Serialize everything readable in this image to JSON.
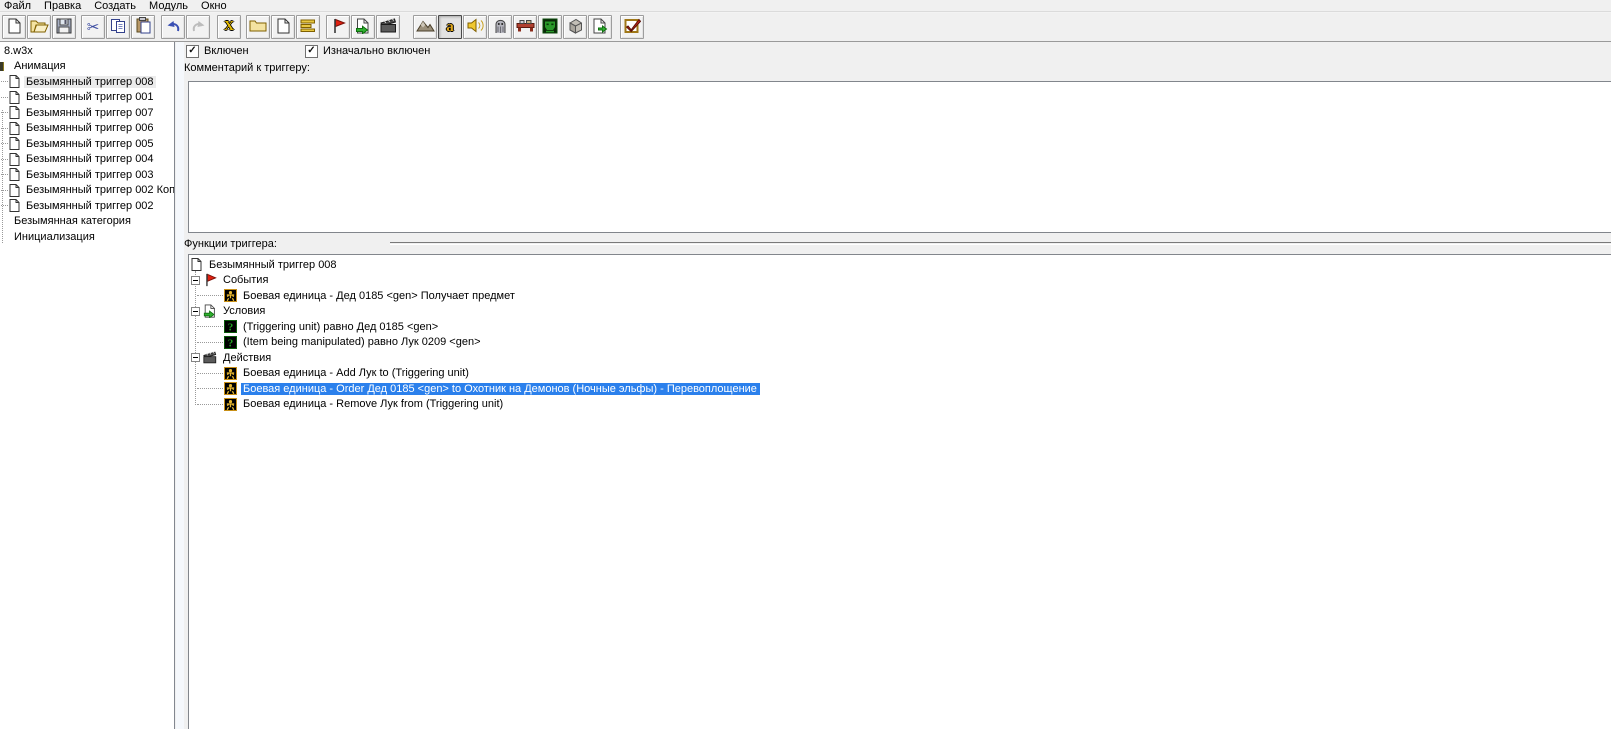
{
  "menu": {
    "items": [
      "Файл",
      "Правка",
      "Создать",
      "Модуль",
      "Окно"
    ]
  },
  "toolbar": {
    "buttons": [
      {
        "name": "new-map"
      },
      {
        "name": "open-map"
      },
      {
        "name": "save-map"
      },
      {
        "name": "cut"
      },
      {
        "name": "copy"
      },
      {
        "name": "paste"
      },
      {
        "name": "undo"
      },
      {
        "name": "redo",
        "disabled": true
      },
      {
        "name": "delete"
      },
      {
        "name": "new-category"
      },
      {
        "name": "new-trigger"
      },
      {
        "name": "new-comment"
      },
      {
        "name": "new-event"
      },
      {
        "name": "new-condition"
      },
      {
        "name": "new-action"
      },
      {
        "name": "terrain-editor"
      },
      {
        "name": "trigger-editor",
        "pressed": true
      },
      {
        "name": "sound-editor"
      },
      {
        "name": "object-editor"
      },
      {
        "name": "campaign-editor"
      },
      {
        "name": "ai-editor"
      },
      {
        "name": "object-manager"
      },
      {
        "name": "import-manager"
      },
      {
        "name": "check-map"
      }
    ]
  },
  "left_tree": {
    "root": "8.w3x",
    "items": [
      {
        "label": "Анимация",
        "type": "category"
      },
      {
        "label": "Безымянный триггер 008",
        "type": "trigger",
        "selected": true
      },
      {
        "label": "Безымянный триггер 001",
        "type": "trigger"
      },
      {
        "label": "Безымянный триггер 007",
        "type": "trigger"
      },
      {
        "label": "Безымянный триггер 006",
        "type": "trigger"
      },
      {
        "label": "Безымянный триггер 005",
        "type": "trigger"
      },
      {
        "label": "Безымянный триггер 004",
        "type": "trigger"
      },
      {
        "label": "Безымянный триггер 003",
        "type": "trigger"
      },
      {
        "label": "Безымянный триггер 002 Коп",
        "type": "trigger"
      },
      {
        "label": "Безымянный триггер 002",
        "type": "trigger"
      },
      {
        "label": "Безымянная категория",
        "type": "category"
      },
      {
        "label": "Инициализация",
        "type": "category"
      }
    ]
  },
  "detail": {
    "enabled": {
      "label": "Включен",
      "checked": true
    },
    "initially_on": {
      "label": "Изначально включен",
      "checked": true
    },
    "comment_label": "Комментарий к триггеру:",
    "comment_value": "",
    "functions_label": "Функции триггера:",
    "functions": {
      "root": "Безымянный триггер 008",
      "sections": [
        {
          "label": "События",
          "items": [
            "Боевая единица - Дед 0185 <gen> Получает предмет"
          ]
        },
        {
          "label": "Условия",
          "items": [
            "(Triggering unit) равно Дед 0185 <gen>",
            "(Item being manipulated) равно Лук 0209 <gen>"
          ]
        },
        {
          "label": "Действия",
          "items": [
            "Боевая единица - Add Лук  to (Triggering unit)",
            "Боевая единица - Order Дед 0185 <gen> to Охотник на Демонов (Ночные эльфы) - Перевоплощение",
            "Боевая единица - Remove Лук  from (Triggering unit)"
          ],
          "selected_index": 1
        }
      ]
    },
    "colors": {
      "selection_blue": "#2b80ec",
      "panel_white": "#ffffff",
      "chrome_gray": "#f0f0f0"
    }
  }
}
